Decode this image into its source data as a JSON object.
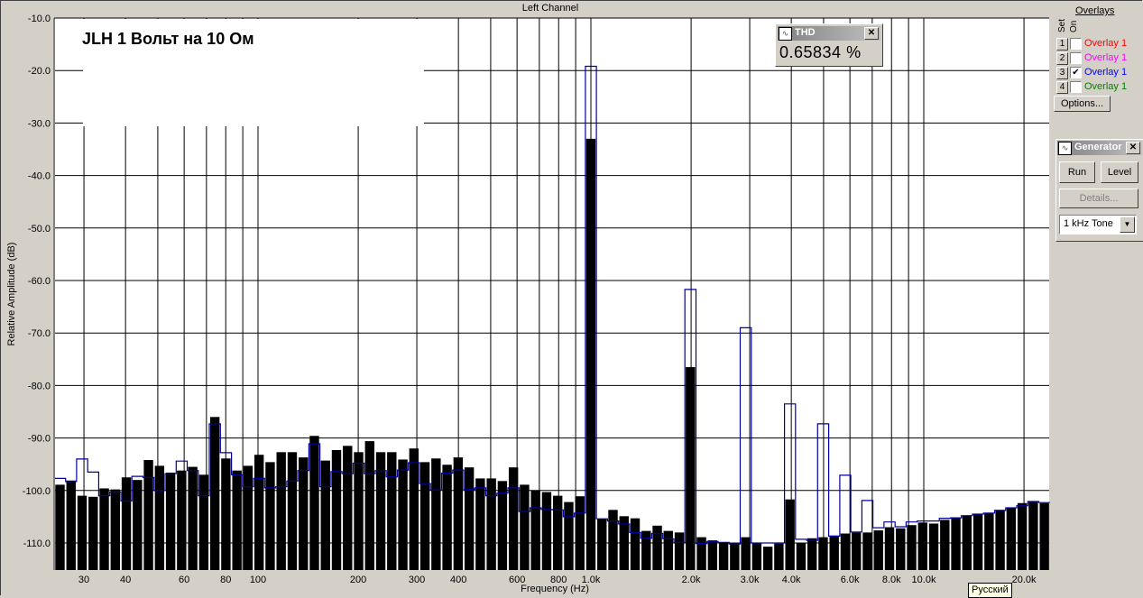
{
  "window": {
    "channel_title": "Left Channel",
    "tooltip": "Русский"
  },
  "annotation": "JLH  1 Вольт на 10 Ом",
  "thd": {
    "title": "THD",
    "value": "0.65834 %",
    "close": "✕"
  },
  "overlays": {
    "title": "Overlays",
    "set_label": "Set",
    "on_label": "On",
    "items": [
      {
        "set": "1",
        "name": "Overlay 1",
        "checked": false,
        "color": "#ff0000"
      },
      {
        "set": "2",
        "name": "Overlay 1",
        "checked": false,
        "color": "#ff00ff"
      },
      {
        "set": "3",
        "name": "Overlay 1",
        "checked": true,
        "color": "#0000ff"
      },
      {
        "set": "4",
        "name": "Overlay 1",
        "checked": false,
        "color": "#008000"
      }
    ],
    "options_label": "Options..."
  },
  "generator": {
    "title": "Generator",
    "run": "Run",
    "level": "Level",
    "details": "Details...",
    "tone": "1 kHz Tone",
    "close": "✕"
  },
  "chart_data": {
    "type": "bar",
    "title": "Left Channel",
    "xlabel": "Frequency (Hz)",
    "ylabel": "Relative Amplitude (dB)",
    "xscale": "log",
    "xlim": [
      24.4,
      23800
    ],
    "ylim": [
      -115,
      -10
    ],
    "grid": true,
    "y_ticks": [
      -10,
      -20,
      -30,
      -40,
      -50,
      -60,
      -70,
      -80,
      -90,
      -100,
      -110
    ],
    "y_tick_labels": [
      "-10.0",
      "-20.0",
      "-30.0",
      "-40.0",
      "-50.0",
      "-60.0",
      "-70.0",
      "-80.0",
      "-90.0",
      "-100.0",
      "-110.0"
    ],
    "x_grid_freqs": [
      30,
      40,
      50,
      60,
      70,
      80,
      90,
      100,
      200,
      300,
      400,
      500,
      600,
      700,
      800,
      900,
      1000,
      2000,
      3000,
      4000,
      5000,
      6000,
      7000,
      8000,
      9000,
      10000,
      20000
    ],
    "x_ticks": [
      30,
      40,
      60,
      80,
      100,
      200,
      300,
      400,
      600,
      800,
      1000,
      2000,
      3000,
      4000,
      6000,
      8000,
      10000,
      20000
    ],
    "x_tick_labels": [
      "30",
      "40",
      "60",
      "80",
      "100",
      "200",
      "300",
      "400",
      "600",
      "800",
      "1.0k",
      "2.0k",
      "3.0k",
      "4.0k",
      "6.0k",
      "8.0k",
      "10.0k",
      "20.0k"
    ],
    "series": [
      {
        "name": "Spectrum",
        "style": "bars",
        "color": "#000000",
        "values": [
          -98.9,
          -98.1,
          -101,
          -101.2,
          -99.6,
          -99.8,
          -97.5,
          -98,
          -94.2,
          -95.3,
          -96.6,
          -96.2,
          -95.5,
          -97,
          -86,
          -93.9,
          -96.2,
          -95.3,
          -93.2,
          -94.6,
          -92.7,
          -92.7,
          -93.7,
          -89.6,
          -94.3,
          -92.3,
          -91.5,
          -92.7,
          -90.6,
          -92.7,
          -92.7,
          -94.1,
          -92,
          -94.6,
          -93.9,
          -95.1,
          -93.7,
          -95.6,
          -97.7,
          -97.7,
          -98.2,
          -95.6,
          -98.9,
          -100,
          -100.3,
          -101,
          -102.2,
          -101.1,
          -33,
          -105.4,
          -103.7,
          -104.9,
          -105.3,
          -107.7,
          -106.7,
          -107.7,
          -108,
          -76.5,
          -108.9,
          -109.5,
          -109.9,
          -110.1,
          -108.9,
          -110,
          -110.7,
          -110.1,
          -101.7,
          -110,
          -109.1,
          -108.9,
          -108.6,
          -108.2,
          -108,
          -108,
          -107.6,
          -107,
          -107.2,
          -106.6,
          -106.1,
          -106.3,
          -105.6,
          -105.2,
          -104.8,
          -104.5,
          -104.3,
          -103.7,
          -103.3,
          -102.4,
          -102.1,
          -102.4
        ]
      },
      {
        "name": "Overlay 1",
        "style": "step",
        "color": "#0000a0",
        "values": [
          -97.7,
          -98.3,
          -94,
          -96.5,
          -101,
          -100.3,
          -102,
          -97.3,
          -97.5,
          -100,
          -96.8,
          -94.4,
          -96.2,
          -101,
          -87.3,
          -92.8,
          -97,
          -99.3,
          -97.7,
          -99.5,
          -99.3,
          -98.2,
          -96.2,
          -91.1,
          -99.3,
          -96.4,
          -96.8,
          -94.8,
          -96.8,
          -96.2,
          -97.4,
          -96.1,
          -94.7,
          -98.7,
          -99.9,
          -96.7,
          -96.1,
          -99.8,
          -99.5,
          -101,
          -100.5,
          -99.5,
          -104,
          -103.3,
          -103.6,
          -103.7,
          -105,
          -104.3,
          -19.2,
          -105.4,
          -105.8,
          -106.4,
          -108,
          -109.1,
          -108.2,
          -109.2,
          -109.9,
          -61.7,
          -110.1,
          -109.7,
          -109.9,
          -110.2,
          -69,
          -110,
          -110,
          -110,
          -83.5,
          -109.3,
          -109.5,
          -87.3,
          -108.7,
          -97.1,
          -107.9,
          -101.9,
          -107.1,
          -106,
          -106.9,
          -106,
          -105.8,
          -105.8,
          -105.3,
          -105.2,
          -104.8,
          -104.5,
          -104.3,
          -103.8,
          -103.3,
          -102.9,
          -102.1,
          -102.3
        ]
      }
    ]
  }
}
